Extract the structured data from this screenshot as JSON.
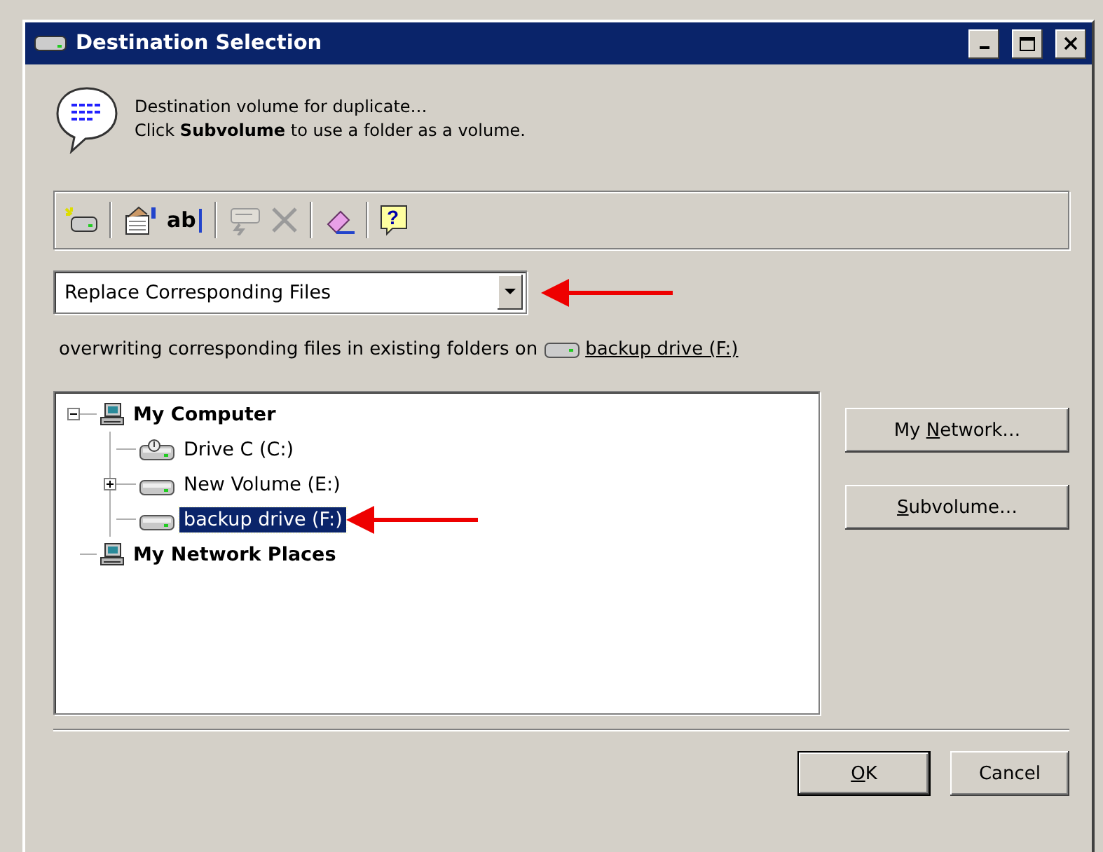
{
  "window": {
    "title": "Destination Selection"
  },
  "header": {
    "line_1": "Destination volume for duplicate…",
    "line_2": "Click **Subvolume** to use a folder as a volume."
  },
  "toolbar": [
    {
      "kind": "new-drive",
      "disabled": false
    },
    {
      "kind": "separator"
    },
    {
      "kind": "properties",
      "disabled": false
    },
    {
      "kind": "rename",
      "label": "ab",
      "disabled": false
    },
    {
      "kind": "separator"
    },
    {
      "kind": "disconnect",
      "disabled": true
    },
    {
      "kind": "delete",
      "disabled": true
    },
    {
      "kind": "separator"
    },
    {
      "kind": "eraser",
      "disabled": false
    },
    {
      "kind": "separator"
    },
    {
      "kind": "help",
      "label": "?",
      "disabled": false
    }
  ],
  "mode_dropdown": {
    "value": "Replace Corresponding Files",
    "marked": true
  },
  "description": {
    "text": "overwriting corresponding files in existing folders on",
    "link": "backup drive (F:)"
  },
  "tree": [
    {
      "label": "My Computer",
      "kind": "computer",
      "expanded": true,
      "selected": false,
      "marked": false,
      "children": [
        {
          "label": "Drive C (C:)",
          "kind": "system-drive",
          "selected": false,
          "marked": false
        },
        {
          "label": "New Volume (E:)",
          "kind": "drive",
          "expanded": false,
          "selected": false,
          "marked": false
        },
        {
          "label": "backup drive (F:)",
          "kind": "drive",
          "selected": true,
          "marked": true
        }
      ]
    },
    {
      "label": "My Network Places",
      "kind": "computer",
      "selected": false,
      "marked": false
    }
  ],
  "side_buttons": [
    {
      "label_start": "My ",
      "access_key": "N",
      "label_rest": "etwork…"
    },
    {
      "access_key": "S",
      "label_rest": "ubvolume…"
    }
  ],
  "footer_buttons": [
    {
      "access_key": "O",
      "label_rest": "K",
      "default": true
    },
    {
      "label_rest": "Cancel",
      "default": false
    }
  ]
}
